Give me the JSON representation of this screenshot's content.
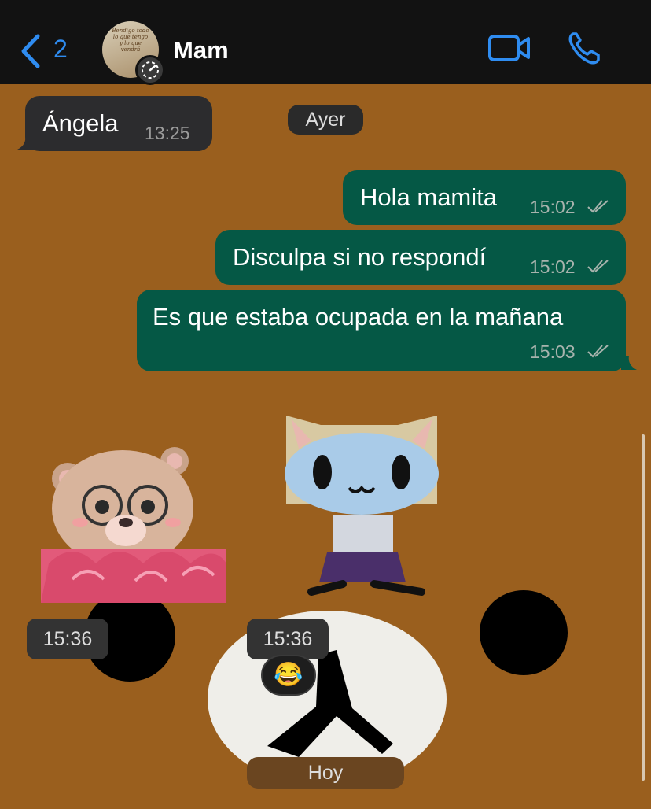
{
  "header": {
    "back_count": "2",
    "title": "Mam",
    "avatar_caption": "Bendigo todo lo que tengo y lo que vendrá"
  },
  "messages": {
    "incoming": {
      "text": "Ángela",
      "time": "13:25"
    },
    "day_label": "Ayer",
    "outgoing": [
      {
        "text": "Hola mamita",
        "time": "15:02"
      },
      {
        "text": "Disculpa si no respondí",
        "time": "15:02"
      },
      {
        "text": "Es que estaba ocupada en la mañana",
        "time": "15:03"
      }
    ],
    "sticker_times": [
      "15:36",
      "15:36"
    ],
    "reaction": "😂",
    "today_label": "Hoy"
  },
  "colors": {
    "chat_background": "#9a5f1e",
    "outgoing_bubble": "#055845",
    "incoming_bubble": "#2c2c2e",
    "accent_blue": "#2f8cf0"
  }
}
